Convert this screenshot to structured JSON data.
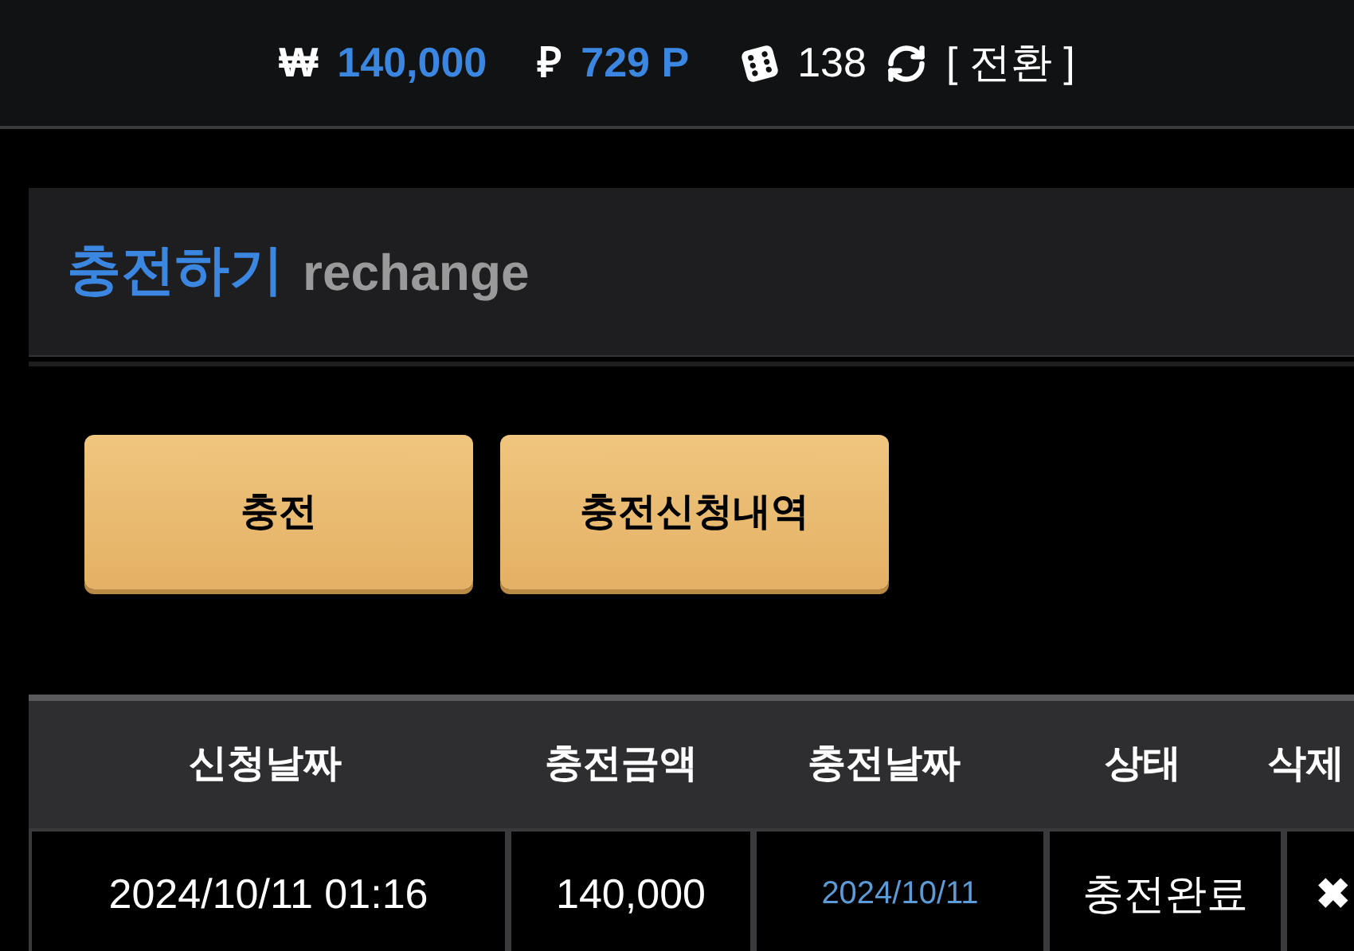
{
  "top_bar": {
    "cash_symbol": "₩",
    "cash": "140,000",
    "point_symbol": "₽",
    "points": "729 P",
    "dice_count": "138",
    "switch_label": "[ 전환 ]"
  },
  "panel": {
    "title": "충전하기",
    "subtitle": "rechange"
  },
  "buttons": [
    {
      "label": "충전"
    },
    {
      "label": "충전신청내역"
    }
  ],
  "table": {
    "columns": [
      "신청날짜",
      "충전금액",
      "충전날짜",
      "상태",
      "삭제"
    ],
    "rows": [
      {
        "requested": "2024/10/11 01:16",
        "amount": "140,000",
        "charged": "2024/10/11",
        "status": "충전완료",
        "delete": "✖"
      }
    ]
  }
}
